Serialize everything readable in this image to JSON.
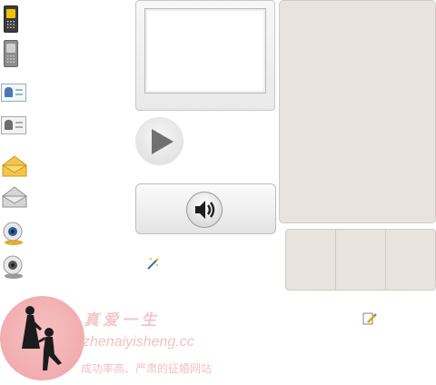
{
  "sidebar": {
    "items": [
      {
        "icon": "mobile-phone-active-icon"
      },
      {
        "icon": "mobile-phone-icon"
      },
      {
        "icon": "contact-card-active-icon"
      },
      {
        "icon": "contact-card-icon"
      },
      {
        "icon": "envelope-active-icon"
      },
      {
        "icon": "envelope-icon"
      },
      {
        "icon": "webcam-active-icon"
      },
      {
        "icon": "webcam-icon"
      }
    ]
  },
  "controls": {
    "play_icon": "play-icon",
    "volume_icon": "speaker-icon",
    "effects_icon": "magic-wand-icon",
    "edit_icon": "pencil-icon"
  },
  "watermark": {
    "title": "真爱一生",
    "domain": "zhenaiyisheng.cc",
    "slogan": "成功率高、严肃的征婚网站"
  },
  "colors": {
    "panel_bg": "#e8e3de",
    "phone_screen_active": "#f2c200",
    "watermark_pink": "#efa4a6"
  }
}
